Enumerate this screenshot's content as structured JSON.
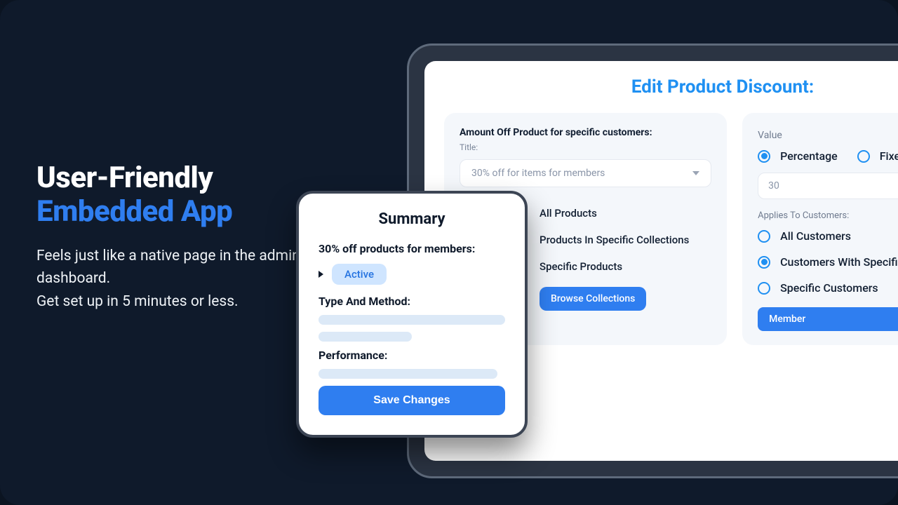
{
  "hero": {
    "title_line1": "User-Friendly",
    "title_line2": "Embedded App",
    "body_line1": "Feels just like a native page in the admin dashboard.",
    "body_line2": "Get set up in 5 minutes or less."
  },
  "screen": {
    "title": "Edit Product Discount:"
  },
  "left_panel": {
    "heading": "Amount Off Product for specific customers:",
    "sublabel": "Title:",
    "select_value": "30% off for items for members",
    "products": {
      "opt_all": "All Products",
      "opt_collections": "Products In Specific Collections",
      "opt_specific": "Specific Products",
      "browse_button": "Browse Collections"
    }
  },
  "right_panel": {
    "value_label": "Value",
    "percentage": "Percentage",
    "fixed": "Fixed Price",
    "value_input": "30",
    "applies_label": "Applies To Customers:",
    "opt_all": "All Customers",
    "opt_tags": "Customers With Specific Tags",
    "opt_specific": "Specific Customers",
    "tag_pill": "Member"
  },
  "summary": {
    "title": "Summary",
    "headline": "30% off products for members:",
    "status": "Active",
    "section_type": "Type And Method:",
    "section_perf": "Performance:",
    "save": "Save Changes"
  }
}
